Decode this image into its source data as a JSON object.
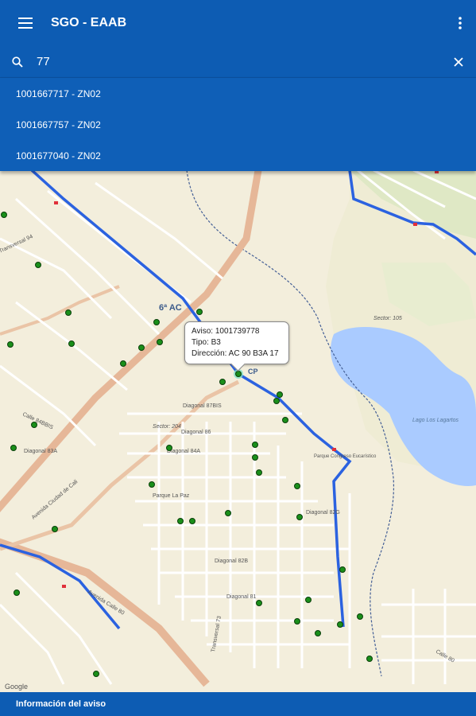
{
  "app": {
    "title": "SGO - EAAB"
  },
  "search": {
    "value": "77",
    "placeholder": ""
  },
  "suggestions": [
    {
      "label": "1001667717 - ZN02"
    },
    {
      "label": "1001667757 - ZN02"
    },
    {
      "label": "1001677040 - ZN02"
    }
  ],
  "popup": {
    "aviso": "Aviso: 1001739778",
    "tipo": "Tipo: B3",
    "direccion": "Dirección: AC 90 B3A 17"
  },
  "map": {
    "labels": {
      "sector_105": "Sector: 105",
      "sector_204": "Sector: 204",
      "lago": "Lago Los Lagartos",
      "ac": "6ª AC",
      "cp": "CP",
      "google": "Google",
      "street_1": "Diagonal 87BIS",
      "street_2": "Diagonal 86",
      "street_3": "Diagonal 84A",
      "street_4": "Diagonal 83A",
      "street_5": "Avenida Ciudad de Cali",
      "street_6": "Avenida Calle 80",
      "street_7": "Transversal 94",
      "street_8": "Parque La Paz",
      "street_9": "Parque Congreso Eucarístico",
      "street_10": "Diagonal 82G",
      "street_11": "Diagonal 82B",
      "street_12": "Diagonal 81",
      "street_13": "Calle 84BBIS",
      "street_14": "Calle 80",
      "street_15": "Transversal 73"
    }
  },
  "bottom": {
    "label": "Información del aviso"
  },
  "colors": {
    "primary": "#0d5cb3",
    "route": "#2b62e0",
    "marker": "#1a8f1a",
    "water": "#aacbff",
    "park": "#cfe6b8"
  }
}
